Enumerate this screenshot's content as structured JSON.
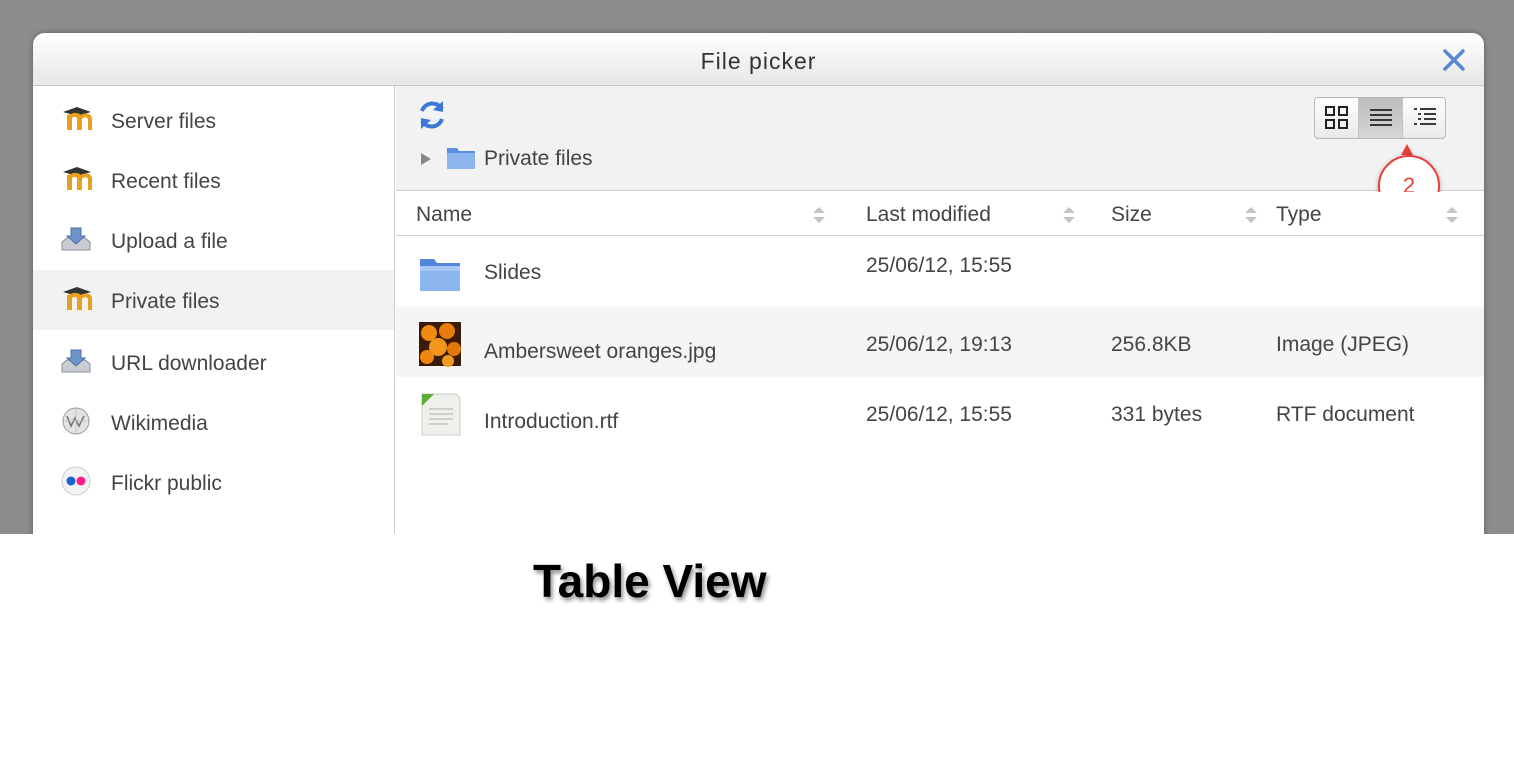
{
  "dialog": {
    "title": "File picker"
  },
  "sidebar": {
    "items": [
      {
        "label": "Server files",
        "icon": "moodle-icon"
      },
      {
        "label": "Recent files",
        "icon": "moodle-icon"
      },
      {
        "label": "Upload a file",
        "icon": "upload-icon"
      },
      {
        "label": "Private files",
        "icon": "moodle-icon",
        "active": true
      },
      {
        "label": "URL downloader",
        "icon": "url-download-icon"
      },
      {
        "label": "Wikimedia",
        "icon": "wikimedia-icon"
      },
      {
        "label": "Flickr public",
        "icon": "flickr-icon"
      }
    ]
  },
  "toolbar": {
    "breadcrumb": "Private files",
    "view_modes": [
      "icons",
      "table",
      "tree"
    ],
    "active_view": "table"
  },
  "callout": {
    "number": "2",
    "color": "#e5403a"
  },
  "table": {
    "columns": [
      "Name",
      "Last modified",
      "Size",
      "Type"
    ],
    "rows": [
      {
        "name": "Slides",
        "modified": "25/06/12, 15:55",
        "size": "",
        "type": "",
        "icon": "folder-icon"
      },
      {
        "name": "Ambersweet oranges.jpg",
        "modified": "25/06/12, 19:13",
        "size": "256.8KB",
        "type": "Image (JPEG)",
        "icon": "image-thumbnail"
      },
      {
        "name": "Introduction.rtf",
        "modified": "25/06/12, 15:55",
        "size": "331 bytes",
        "type": "RTF document",
        "icon": "document-icon"
      }
    ]
  },
  "caption": "Table View",
  "colors": {
    "accent": "#4a7bd0",
    "moodle_orange": "#e8a020"
  }
}
